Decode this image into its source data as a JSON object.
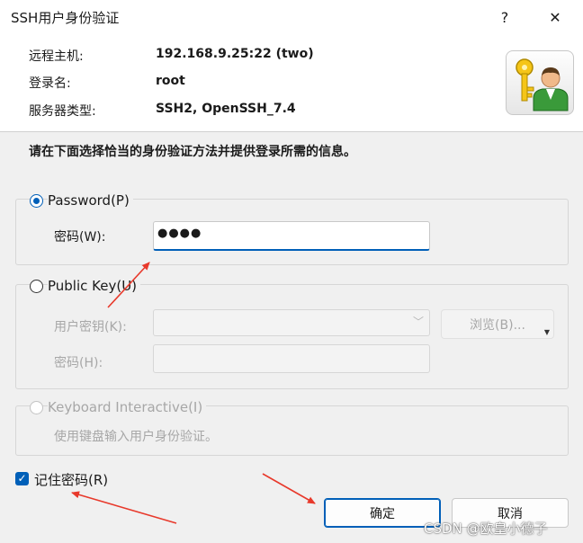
{
  "window": {
    "title": "SSH用户身份验证",
    "help_icon": "?",
    "close_icon": "✕"
  },
  "info": {
    "remote_host_label": "远程主机:",
    "remote_host_value": "192.168.9.25:22 (two)",
    "login_label": "登录名:",
    "login_value": "root",
    "server_type_label": "服务器类型:",
    "server_type_value": "SSH2, OpenSSH_7.4"
  },
  "instruction": "请在下面选择恰当的身份验证方法并提供登录所需的信息。",
  "password_option": {
    "label": "Password(P)",
    "checked": true,
    "field_label": "密码(W):",
    "field_value": "●●●●"
  },
  "publickey_option": {
    "label": "Public Key(U)",
    "checked": false,
    "user_key_label": "用户密钥(K):",
    "user_key_value": "",
    "browse_label": "浏览(B)...",
    "passphrase_label": "密码(H):"
  },
  "keyboard_option": {
    "label": "Keyboard Interactive(I)",
    "checked": false,
    "description": "使用键盘输入用户身份验证。"
  },
  "remember": {
    "label": "记住密码(R)",
    "checked": true
  },
  "buttons": {
    "ok": "确定",
    "cancel": "取消"
  },
  "watermark": "CSDN @欧皇小德子",
  "colors": {
    "accent": "#005fb8",
    "annotation_arrow": "#e8392b"
  }
}
